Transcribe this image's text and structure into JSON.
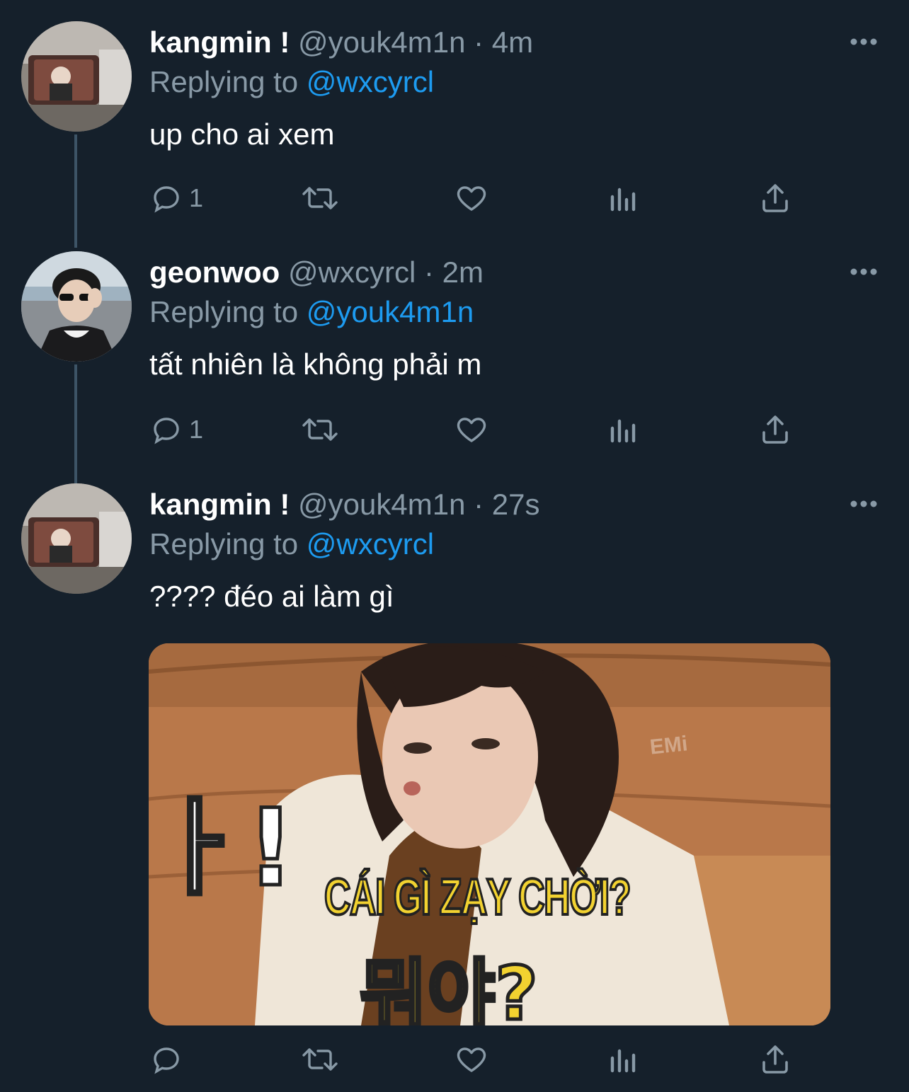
{
  "tweets": [
    {
      "name": "kangmin !",
      "handle": "@youk4m1n",
      "time": "4m",
      "replying_label": "Replying to",
      "replying_to": "@wxcyrcl",
      "text": "up cho ai xem",
      "reply_count": "1",
      "avatar": "car-mirror-selfie-avatar"
    },
    {
      "name": "geonwoo",
      "handle": "@wxcyrcl",
      "time": "2m",
      "replying_label": "Replying to",
      "replying_to": "@youk4m1n",
      "text": "tất nhiên là không phải m",
      "reply_count": "1",
      "avatar": "sunglasses-portrait-avatar"
    },
    {
      "name": "kangmin !",
      "handle": "@youk4m1n",
      "time": "27s",
      "replying_label": "Replying to",
      "replying_to": "@wxcyrcl",
      "text": "???? đéo ai làm gì",
      "reply_count": "",
      "avatar": "car-mirror-selfie-avatar",
      "media": {
        "caption_vi": "CÁI GÌ ZẠY CHỜI?",
        "caption_ko": "뭐야?",
        "caption_left": "ㅏ!",
        "watermark": "EMi"
      }
    }
  ],
  "separator": "·",
  "colors": {
    "background": "#15202b",
    "secondary_text": "#8899a6",
    "link": "#1d9bf0",
    "thread_line": "#3d5466"
  }
}
